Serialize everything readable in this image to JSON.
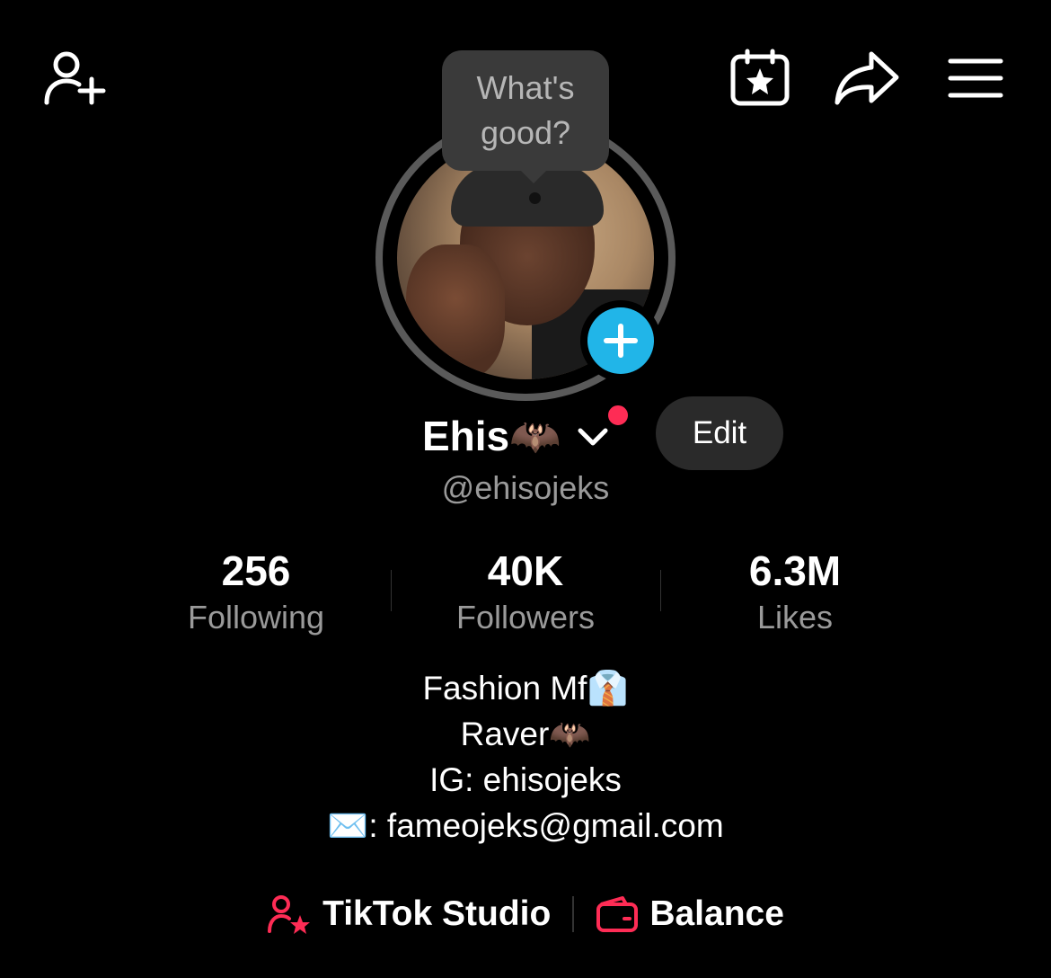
{
  "header": {
    "add_friend_icon": "person-plus-icon",
    "calendar_icon": "calendar-star-icon",
    "share_icon": "share-arrow-icon",
    "menu_icon": "hamburger-menu-icon"
  },
  "avatar": {
    "bubble_line1": "What's",
    "bubble_line2": "good?",
    "add_icon": "plus-icon"
  },
  "profile": {
    "display_name": "Ehis🦇",
    "username": "@ehisojeks",
    "edit_label": "Edit"
  },
  "stats": [
    {
      "value": "256",
      "label": "Following"
    },
    {
      "value": "40K",
      "label": "Followers"
    },
    {
      "value": "6.3M",
      "label": "Likes"
    }
  ],
  "bio": [
    "Fashion Mf👔",
    "Raver🦇",
    "IG: ehisojeks",
    "✉️: fameojeks@gmail.com"
  ],
  "actions": {
    "studio_label": "TikTok Studio",
    "balance_label": "Balance"
  },
  "colors": {
    "accent_red": "#fe2c55",
    "accent_blue": "#21b5e8",
    "background": "#000000"
  }
}
